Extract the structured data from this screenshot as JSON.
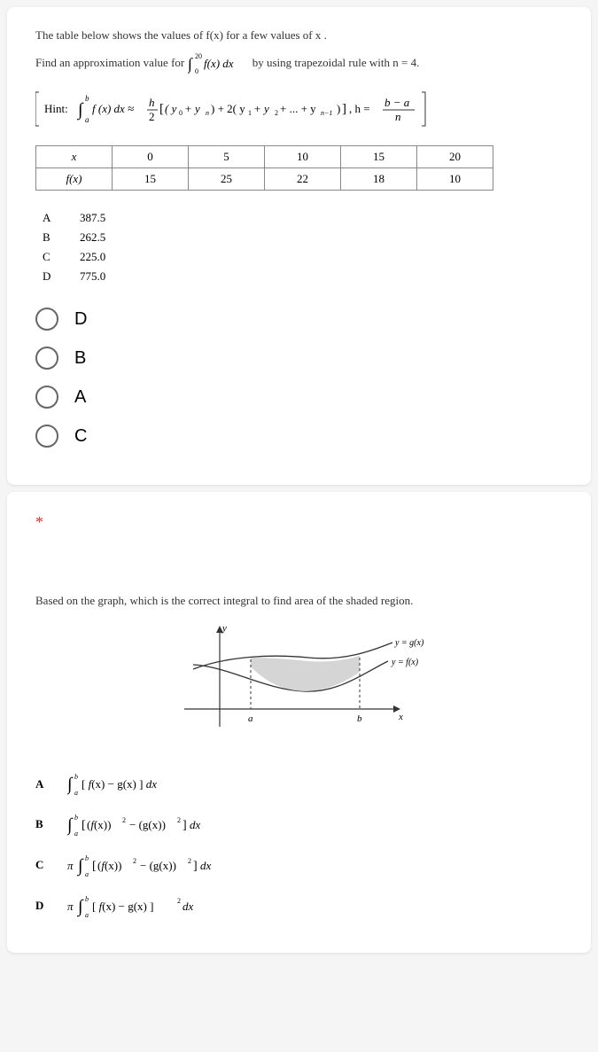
{
  "q1": {
    "intro": "The table below shows the values of  f(x)  for a few values of  x .",
    "prompt_prefix": "Find an approximation value for ",
    "prompt_suffix": " by using trapezoidal rule with  n = 4.",
    "hint_label": "Hint:",
    "table": {
      "headers": [
        "x",
        "0",
        "5",
        "10",
        "15",
        "20"
      ],
      "row": [
        "f(x)",
        "15",
        "25",
        "22",
        "18",
        "10"
      ]
    },
    "answers": [
      {
        "label": "A",
        "value": "387.5"
      },
      {
        "label": "B",
        "value": "262.5"
      },
      {
        "label": "C",
        "value": "225.0"
      },
      {
        "label": "D",
        "value": "775.0"
      }
    ],
    "options": [
      "D",
      "B",
      "A",
      "C"
    ]
  },
  "q2": {
    "star": "*",
    "prompt": "Based on the graph, which is the correct integral to find area of the shaded region.",
    "graph": {
      "y_axis": "y",
      "x_axis": "x",
      "a_label": "a",
      "b_label": "b",
      "g_label": "y = g(x)",
      "f_label": "y = f(x)"
    },
    "answers_labels": [
      "A",
      "B",
      "C",
      "D"
    ]
  }
}
